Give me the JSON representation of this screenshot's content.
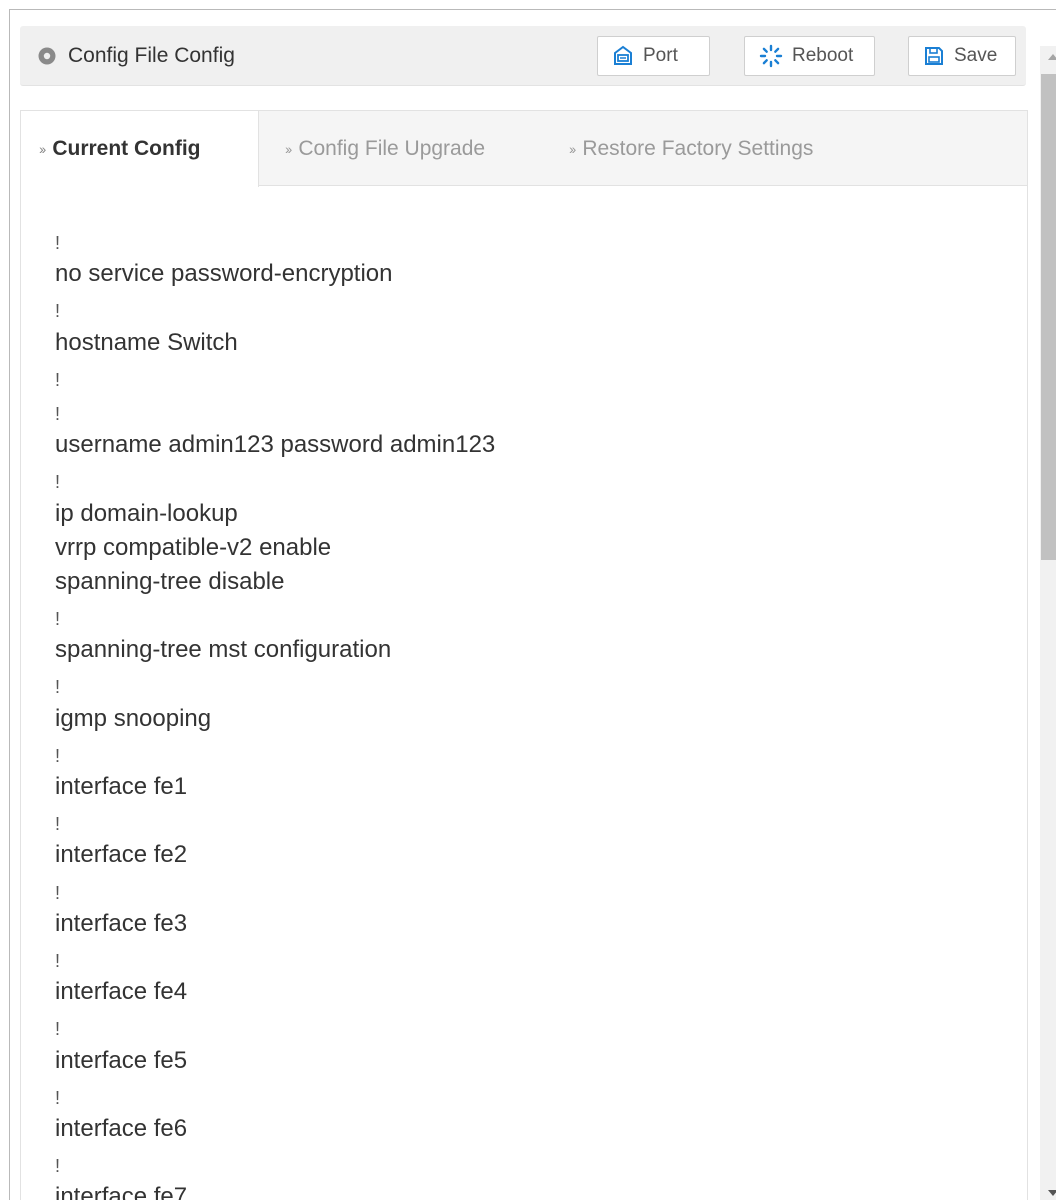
{
  "header": {
    "title": "Config File Config",
    "buttons": {
      "port": "Port",
      "reboot": "Reboot",
      "save": "Save"
    }
  },
  "tabs": [
    {
      "label": "Current Config",
      "active": true
    },
    {
      "label": "Config File Upgrade",
      "active": false
    },
    {
      "label": "Restore Factory Settings",
      "active": false
    }
  ],
  "config_lines": [
    "!",
    "no service password-encryption",
    "!",
    "hostname Switch",
    "!",
    "!",
    "username admin123 password admin123",
    "!",
    "ip domain-lookup",
    "vrrp compatible-v2 enable",
    "spanning-tree disable",
    "!",
    "spanning-tree mst configuration",
    "!",
    "igmp snooping",
    "!",
    "interface fe1",
    "!",
    "interface fe2",
    "!",
    "interface fe3",
    "!",
    "interface fe4",
    "!",
    "interface fe5",
    "!",
    "interface fe6",
    "!",
    "interface fe7"
  ],
  "colors": {
    "header_bg": "#f0f0f0",
    "icon_blue": "#1a7fd4",
    "text": "#333333",
    "muted_tab": "#9a9a9a"
  }
}
